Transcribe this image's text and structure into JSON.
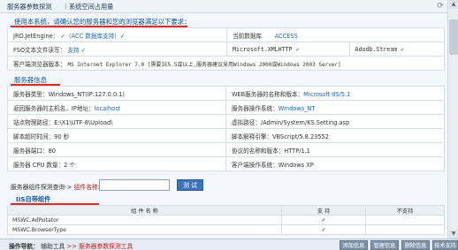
{
  "tabs": {
    "tab1": "服务器参数探测",
    "sep": "|",
    "tab2": "系统空间占用量"
  },
  "requirements": {
    "title": "使用本系统，请确认您的服务器和您的浏览器满足以下要求：",
    "jro_label": "JRO.JetEngine：",
    "jro_value": "✓（ACC 数据库支持）✓",
    "db_label": "当前数据库",
    "db_value": "ACCESS",
    "fso_label": "FSO文本文件读写：",
    "fso_value": "支持 ✓",
    "xmlhttp": "Microsoft.XMLHTTP ✓",
    "adodb": "Adodb.Stream ✓",
    "client_label": "客户端浏览器版本：",
    "client_value": "MS Internet Explorer 7.0 [需要IE5.5或以上,服务器建议采用Windows 2000或Windows 2003 Server]"
  },
  "server_info": {
    "title": "服务器信息",
    "rows": [
      {
        "l1": "服务器类型：",
        "v1": "Windows_NT(IP:127.0.0.1)",
        "v1_blue": false,
        "l2": "WEB服务器的名称和版本：",
        "v2": "Microsoft-IIS/5.1",
        "v2_blue": true
      },
      {
        "l1": "返回服务器的主机名，IP地址：",
        "v1": "localhost",
        "v1_blue": true,
        "l2": "服务器操作系统：",
        "v2": "Windows_NT",
        "v2_blue": true
      },
      {
        "l1": "站点物理路径：",
        "v1": "E:\\X1\\UTF-8\\Upload\\",
        "v1_blue": false,
        "l2": "虚拟路径：",
        "v2": "/Admin/System/KS.Setting.asp",
        "v2_blue": false
      },
      {
        "l1": "脚本超时时间：",
        "v1": "90 秒",
        "v1_blue": false,
        "l2": "脚本解释引擎：",
        "v2": "VBScript/5.8.23552",
        "v2_blue": false
      },
      {
        "l1": "服务器端口：",
        "v1": "80",
        "v1_blue": false,
        "l2": "协议的名称和版本：",
        "v2": "HTTP/1.1",
        "v2_blue": false
      },
      {
        "l1": "服务器 CPU 数量：",
        "v1": "2 个",
        "v1_blue": false,
        "l2": "客户端操作系统：",
        "v2": "Windows XP",
        "v2_blue": false
      }
    ]
  },
  "probe": {
    "label": "服务器组件探测查询->",
    "label_red": "组件名称:",
    "input_value": "",
    "button": "测 试"
  },
  "iis": {
    "title": "IIS自带组件",
    "headers": [
      "组 件 名 称",
      "支 持",
      "不支持"
    ],
    "rows": [
      {
        "name": "MSWC.AdRotator",
        "support": "✓",
        "nosupport": ""
      },
      {
        "name": "MSWC.BrowserType",
        "support": "✓",
        "nosupport": ""
      }
    ]
  },
  "statusbar": {
    "prefix": "操作导航：",
    "nav1": "辅助工具",
    "arrow": ">>",
    "current": "服务器参数探测工具",
    "buttons": [
      "添加信息",
      "管理信息",
      "删除信息",
      "技术支持"
    ]
  },
  "colors": {
    "accent": "#0d5aa7",
    "red": "#e02a2a",
    "button": "#3d74b8"
  }
}
